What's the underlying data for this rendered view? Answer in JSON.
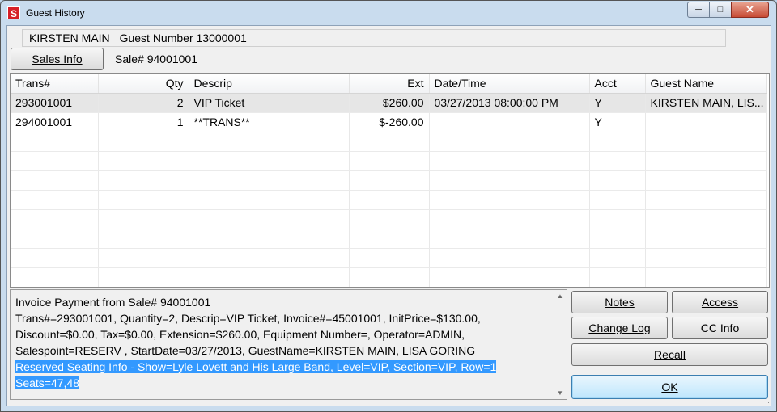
{
  "window": {
    "title": "Guest History"
  },
  "header": {
    "guest_name": "KIRSTEN MAIN",
    "guest_number": "Guest Number 13000001",
    "sales_info_button": "Sales Info",
    "sale_label": "Sale# 94001001"
  },
  "grid": {
    "columns": [
      "Trans#",
      "Qty",
      "Descrip",
      "Ext",
      "Date/Time",
      "Acct",
      "Guest Name"
    ],
    "rows": [
      {
        "trans": "293001001",
        "qty": "2",
        "descrip": "VIP Ticket",
        "ext": "$260.00",
        "datetime": "03/27/2013 08:00:00 PM",
        "acct": "Y",
        "guest": "KIRSTEN MAIN, LIS..."
      },
      {
        "trans": "294001001",
        "qty": "1",
        "descrip": "**TRANS**",
        "ext": "$-260.00",
        "datetime": "",
        "acct": "Y",
        "guest": ""
      }
    ]
  },
  "info": {
    "lines": [
      "Invoice Payment from Sale# 94001001",
      "Trans#=293001001, Quantity=2, Descrip=VIP Ticket, Invoice#=45001001, InitPrice=$130.00,",
      "Discount=$0.00, Tax=$0.00, Extension=$260.00, Equipment Number=, Operator=ADMIN,",
      "Salespoint=RESERV , StartDate=03/27/2013, GuestName=KIRSTEN MAIN, LISA GORING"
    ],
    "selected_lines": [
      "Reserved Seating Info  - Show=Lyle Lovett and His Large Band, Level=VIP, Section=VIP, Row=1",
      "Seats=47,48"
    ]
  },
  "buttons": {
    "notes": "Notes",
    "access": "Access",
    "change_log": "Change Log",
    "cc_info": "CC Info",
    "recall": "Recall",
    "ok": "OK"
  }
}
